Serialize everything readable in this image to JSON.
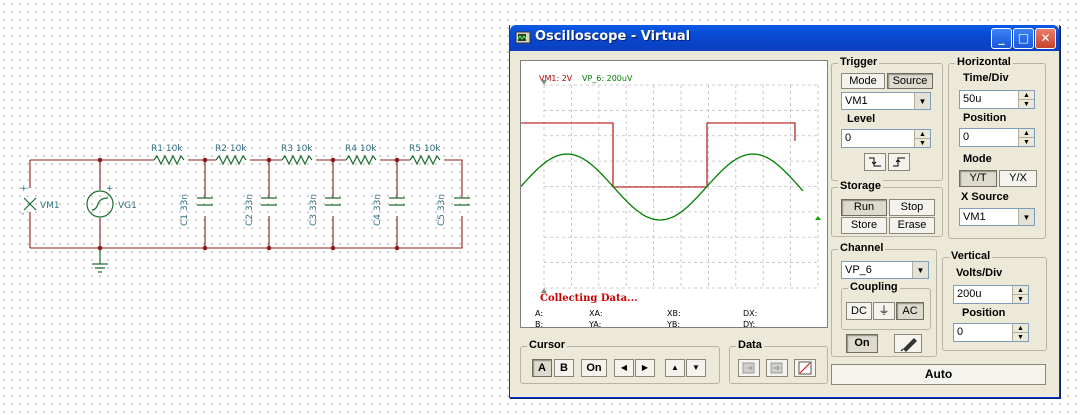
{
  "schematic": {
    "resistors": [
      {
        "label": "R1 10k"
      },
      {
        "label": "R2 10k"
      },
      {
        "label": "R3 10k"
      },
      {
        "label": "R4 10k"
      },
      {
        "label": "R5 10k"
      }
    ],
    "capacitors": [
      {
        "label": "C1 33n"
      },
      {
        "label": "C2 33n"
      },
      {
        "label": "C3 33n"
      },
      {
        "label": "C4 33n"
      },
      {
        "label": "C5 33n"
      }
    ],
    "meter_label": "VM1",
    "generator_label": "VG1",
    "plus": "+",
    "minus": "-"
  },
  "window": {
    "title": "Oscilloscope - Virtual",
    "min_glyph": "_",
    "max_glyph": "□",
    "close_glyph": "✕"
  },
  "screen": {
    "ch1_readout": "VM1: 2V",
    "ch2_readout": "VP_6: 200uV",
    "status": "Collecting Data...",
    "cursor_fields": [
      "A:",
      "XA:",
      "XB:",
      "DX:",
      "B:",
      "YA:",
      "YB:",
      "DY:"
    ],
    "ch1_color": "#aa0000",
    "ch2_color": "#008000"
  },
  "trigger": {
    "title": "Trigger",
    "mode_label": "Mode",
    "source_label": "Source",
    "source_value": "VM1",
    "level_label": "Level",
    "level_value": "0"
  },
  "storage": {
    "title": "Storage",
    "run": "Run",
    "stop": "Stop",
    "store": "Store",
    "erase": "Erase"
  },
  "horizontal": {
    "title": "Horizontal",
    "timediv_label": "Time/Div",
    "timediv_value": "50u",
    "position_label": "Position",
    "position_value": "0",
    "mode_label": "Mode",
    "yt": "Y/T",
    "yx": "Y/X",
    "xsource_label": "X Source",
    "xsource_value": "VM1"
  },
  "channel": {
    "title": "Channel",
    "value": "VP_6",
    "coupling_label": "Coupling",
    "dc": "DC",
    "gnd": "⏚",
    "ac": "AC",
    "on": "On"
  },
  "vertical": {
    "title": "Vertical",
    "voltsdiv_label": "Volts/Div",
    "voltsdiv_value": "200u",
    "position_label": "Position",
    "position_value": "0"
  },
  "cursor": {
    "title": "Cursor",
    "a": "A",
    "b": "B",
    "on": "On",
    "left": "◀",
    "right": "▶",
    "up": "▲",
    "down": "▼"
  },
  "data": {
    "title": "Data"
  },
  "auto_label": "Auto"
}
